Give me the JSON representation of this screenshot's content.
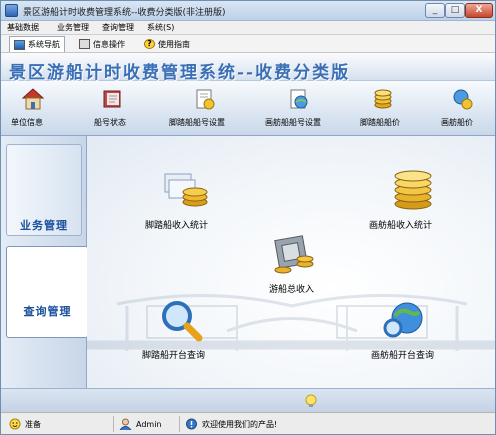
{
  "window": {
    "title": "景区游船计时收费管理系统--收费分类版(非注册版)",
    "controls": {
      "minimize": "_",
      "maximize": "□",
      "close": "X"
    }
  },
  "menu": {
    "items": [
      {
        "label": "基础数据"
      },
      {
        "label": "业务管理"
      },
      {
        "label": "查询管理"
      },
      {
        "label": "系统(S)"
      }
    ]
  },
  "tabs": [
    {
      "label": "系统导航",
      "icon": "nav-icon",
      "active": true
    },
    {
      "label": "信息操作",
      "icon": "info-icon",
      "active": false
    },
    {
      "label": "使用指南",
      "icon": "help-icon",
      "active": false,
      "glyph": "?"
    }
  ],
  "banner": {
    "title": "景区游船计时收费管理系统--收费分类版"
  },
  "toolbar": {
    "items": [
      {
        "label": "单位信息",
        "icon": "house-icon"
      },
      {
        "label": "船号状态",
        "icon": "book-icon"
      },
      {
        "label": "脚踏船船号设置",
        "icon": "settings-doc-icon"
      },
      {
        "label": "画舫船船号设置",
        "icon": "globe-doc-icon"
      },
      {
        "label": "脚踏船船价",
        "icon": "coins-icon"
      },
      {
        "label": "画舫船价",
        "icon": "globe-coin-icon"
      }
    ]
  },
  "leftnav": {
    "items": [
      {
        "label": "业务管理",
        "selected": false
      },
      {
        "label": "查询管理",
        "selected": true
      }
    ]
  },
  "main": {
    "tiles": [
      {
        "label": "脚踏船收入统计",
        "icon": "coins-stack-icon"
      },
      {
        "label": "画舫船收入统计",
        "icon": "gold-coins-icon"
      },
      {
        "label": "游船总收入",
        "icon": "money-box-icon"
      },
      {
        "label": "脚踏船开台查询",
        "icon": "magnifier-icon"
      },
      {
        "label": "画舫船开台查询",
        "icon": "globe-search-icon"
      }
    ]
  },
  "status": {
    "state": "准备",
    "user": "Admin",
    "message": "欢迎使用我们的产品!"
  },
  "colors": {
    "banner_text": "#3a6fb6",
    "nav_text": "#1a4f9c",
    "toolbar_gradient_top": "#f7fafd",
    "toolbar_gradient_bottom": "#c9d8ea"
  }
}
